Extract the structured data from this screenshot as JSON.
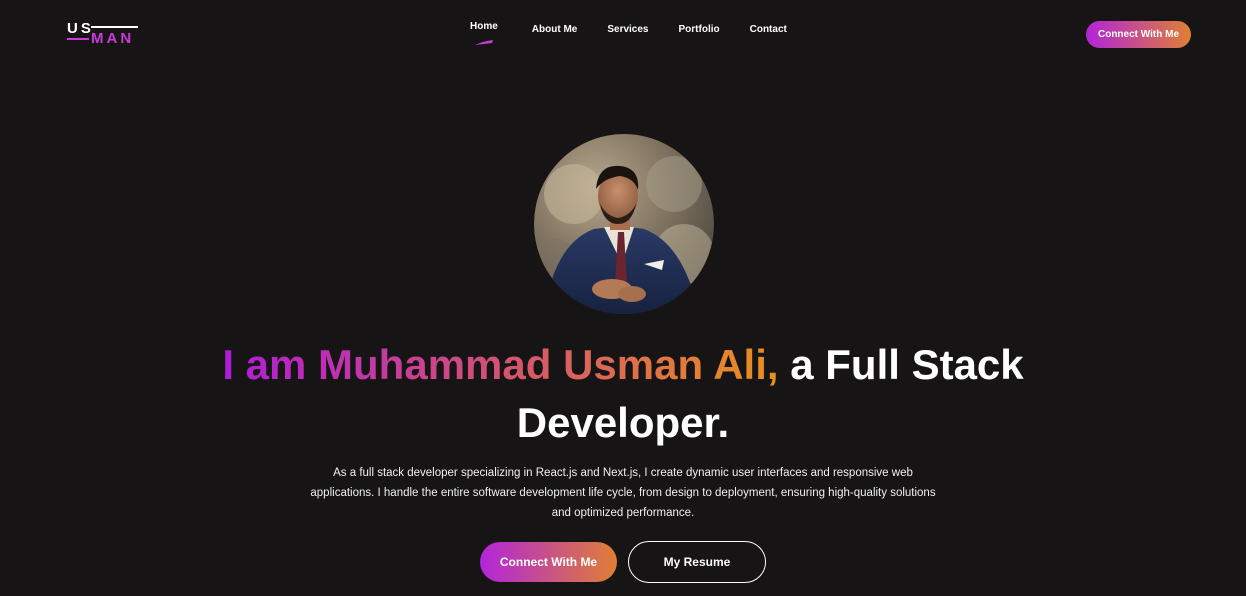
{
  "logo": {
    "top": "US",
    "bottom": "MAN"
  },
  "nav": {
    "items": [
      {
        "label": "Home",
        "active": true
      },
      {
        "label": "About Me"
      },
      {
        "label": "Services"
      },
      {
        "label": "Portfolio"
      },
      {
        "label": "Contact"
      }
    ]
  },
  "header": {
    "cta_label": "Connect With Me"
  },
  "hero": {
    "title_highlight": "I am Muhammad Usman Ali,",
    "title_rest_line1": " a Full Stack",
    "title_line2": "Developer.",
    "description": "As a full stack developer specializing in React.js and Next.js, I create dynamic user interfaces and responsive web applications. I handle the entire software development life cycle, from design to deployment, ensuring high-quality solutions and optimized performance.",
    "primary_button": "Connect With Me",
    "secondary_button": "My Resume"
  },
  "colors": {
    "background": "#161414",
    "accent_start": "#b225d9",
    "accent_end": "#df7f34"
  }
}
